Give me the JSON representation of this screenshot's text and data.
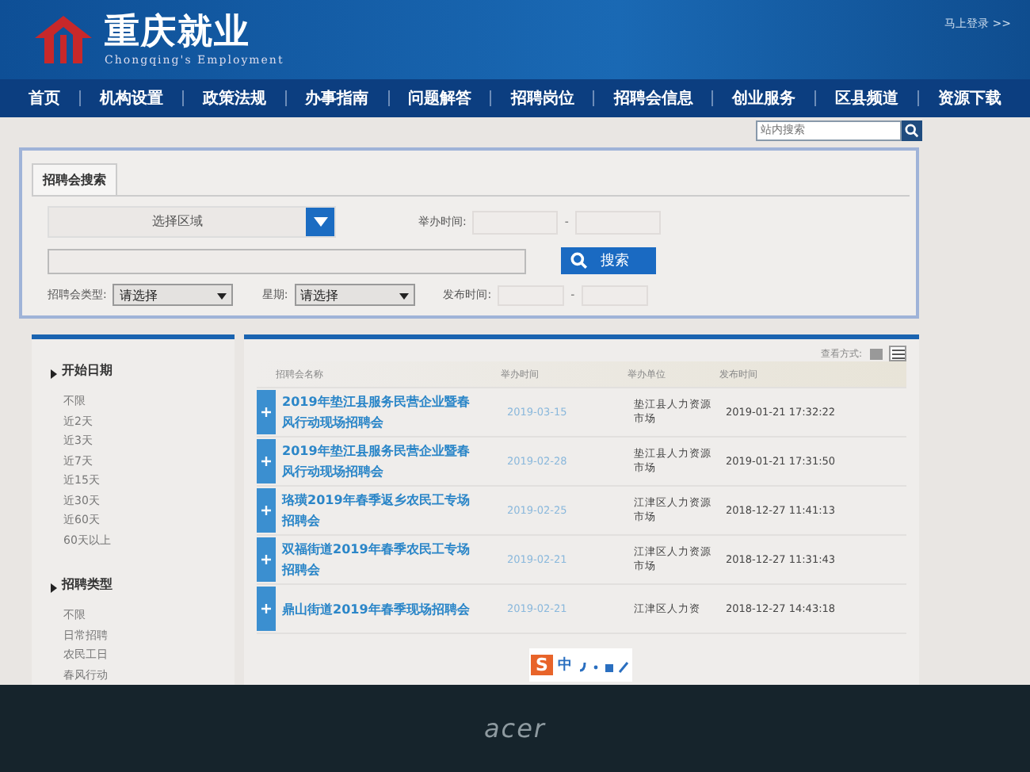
{
  "header": {
    "title": "重庆就业",
    "subtitle": "Chongqing's Employment",
    "login_link": "马上登录 >>"
  },
  "nav": [
    "首页",
    "机构设置",
    "政策法规",
    "办事指南",
    "问题解答",
    "招聘岗位",
    "招聘会信息",
    "创业服务",
    "区县频道",
    "资源下载"
  ],
  "site_search": {
    "placeholder": "站内搜索"
  },
  "search_panel": {
    "tab": "招聘会搜索",
    "region_select": "选择区域",
    "held_time_label": "举办时间:",
    "held_time_separator": "-",
    "search_button": "搜索",
    "type_label": "招聘会类型:",
    "type_select": "请选择",
    "week_label": "星期:",
    "week_select": "请选择",
    "publish_label": "发布时间:",
    "publish_separator": "-"
  },
  "sidebar": [
    {
      "title": "开始日期",
      "items": [
        "不限",
        "近2天",
        "近3天",
        "近7天",
        "近15天",
        "近30天",
        "近60天",
        "60天以上"
      ]
    },
    {
      "title": "招聘类型",
      "items": [
        "不限",
        "日常招聘",
        "农民工日",
        "春风行动"
      ]
    }
  ],
  "list": {
    "view_label": "查看方式:",
    "view_modes": [
      {
        "kind": "grid",
        "selected": false
      },
      {
        "kind": "list",
        "selected": true
      }
    ],
    "columns": [
      "招聘会名称",
      "举办时间",
      "举办单位",
      "发布时间"
    ],
    "rows": [
      {
        "name": "2019年垫江县服务民营企业暨春风行动现场招聘会",
        "date": "2019-03-15",
        "org": "垫江县人力资源市场",
        "published": "2019-01-21 17:32:22"
      },
      {
        "name": "2019年垫江县服务民营企业暨春风行动现场招聘会",
        "date": "2019-02-28",
        "org": "垫江县人力资源市场",
        "published": "2019-01-21 17:31:50"
      },
      {
        "name": "珞璜2019年春季返乡农民工专场招聘会",
        "date": "2019-02-25",
        "org": "江津区人力资源市场",
        "published": "2018-12-27 11:41:13"
      },
      {
        "name": "双福街道2019年春季农民工专场招聘会",
        "date": "2019-02-21",
        "org": "江津区人力资源市场",
        "published": "2018-12-27 11:31:43"
      },
      {
        "name": "鼎山街道2019年春季现场招聘会",
        "date": "2019-02-21",
        "org": "江津区人力资",
        "published": "2018-12-27 14:43:18"
      }
    ]
  },
  "ime_toolbar": {
    "logo": "S",
    "mode": "中"
  },
  "bezel": {
    "brand": "acer"
  }
}
